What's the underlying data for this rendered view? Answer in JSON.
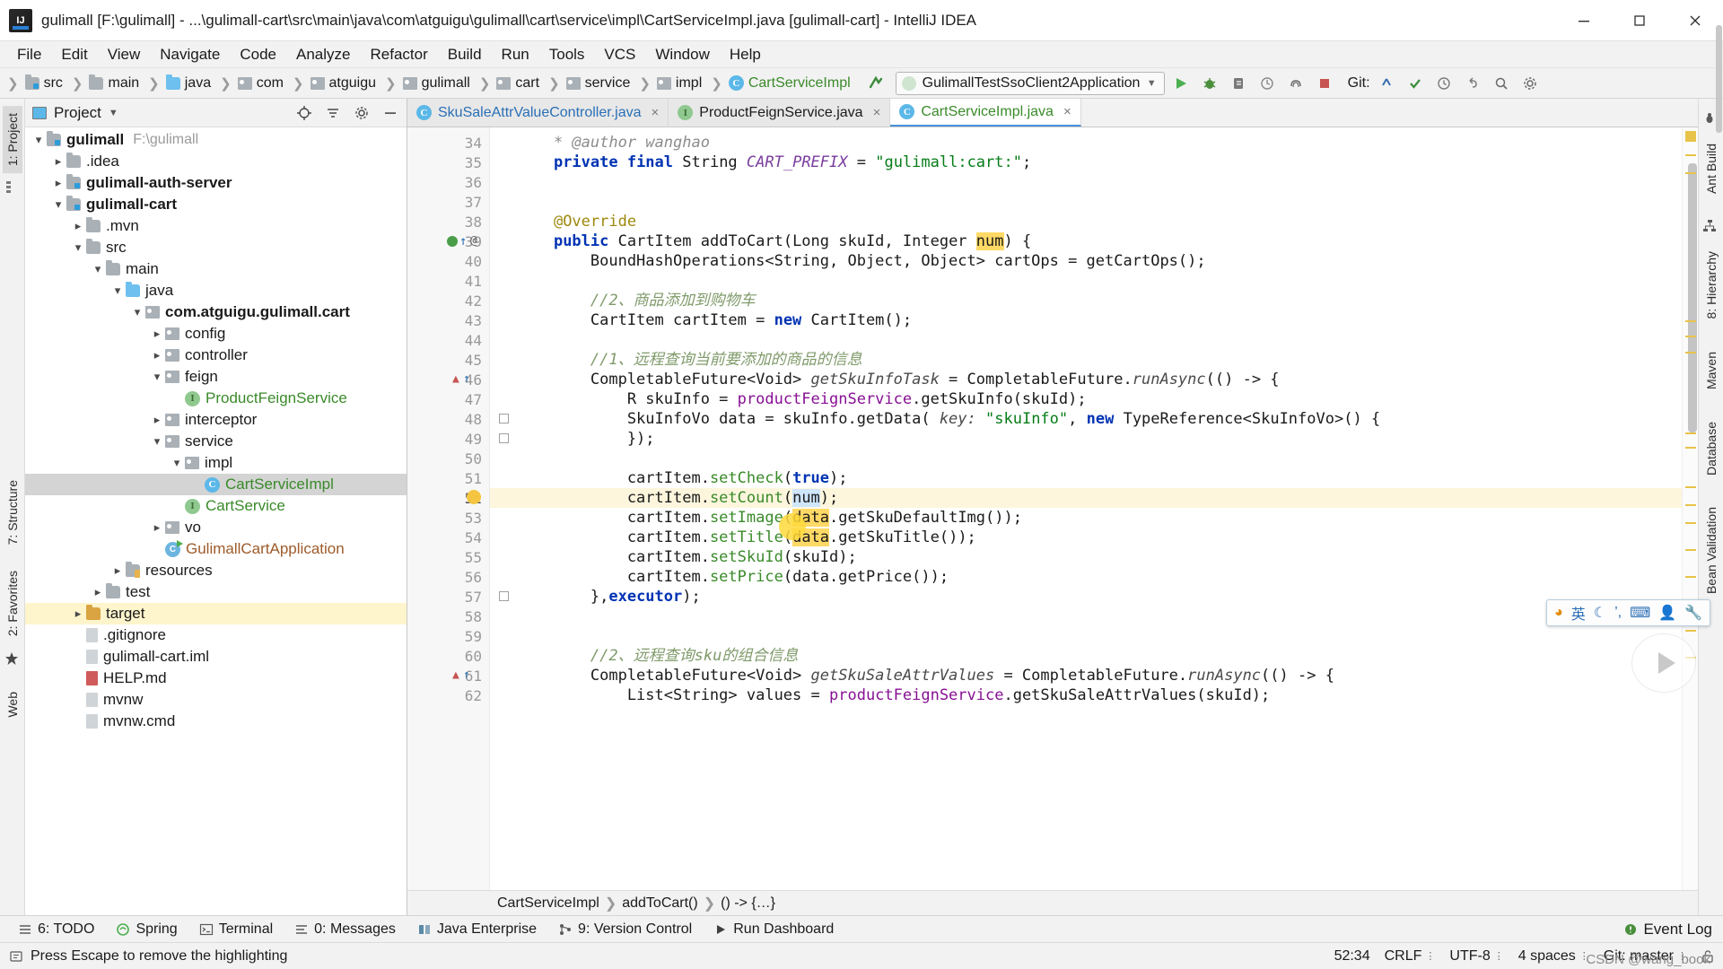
{
  "window": {
    "title": "gulimall [F:\\gulimall] - ...\\gulimall-cart\\src\\main\\java\\com\\atguigu\\gulimall\\cart\\service\\impl\\CartServiceImpl.java [gulimall-cart] - IntelliJ IDEA",
    "app_icon": "intellij-idea-logo",
    "minimize": "minimize-icon",
    "maximize": "maximize-icon",
    "close": "close-icon"
  },
  "menubar": [
    {
      "label": "File"
    },
    {
      "label": "Edit"
    },
    {
      "label": "View"
    },
    {
      "label": "Navigate"
    },
    {
      "label": "Code"
    },
    {
      "label": "Analyze"
    },
    {
      "label": "Refactor"
    },
    {
      "label": "Build"
    },
    {
      "label": "Run"
    },
    {
      "label": "Tools"
    },
    {
      "label": "VCS"
    },
    {
      "label": "Window"
    },
    {
      "label": "Help"
    }
  ],
  "navbar": {
    "crumbs": [
      {
        "label": "src",
        "icon": "folder-src-icon"
      },
      {
        "label": "main",
        "icon": "folder-icon"
      },
      {
        "label": "java",
        "icon": "folder-java-icon"
      },
      {
        "label": "com",
        "icon": "package-icon"
      },
      {
        "label": "atguigu",
        "icon": "package-icon"
      },
      {
        "label": "gulimall",
        "icon": "package-icon"
      },
      {
        "label": "cart",
        "icon": "package-icon"
      },
      {
        "label": "service",
        "icon": "package-icon"
      },
      {
        "label": "impl",
        "icon": "package-icon"
      },
      {
        "label": "CartServiceImpl",
        "icon": "java-class-icon",
        "green": true
      }
    ],
    "run_configuration": "GulimallTestSsoClient2Application",
    "run_config_icon": "spring-boot-icon",
    "buttons": [
      {
        "name": "run-button",
        "icon": "play-icon"
      },
      {
        "name": "debug-button",
        "icon": "bug-icon"
      },
      {
        "name": "run-with-coverage-button",
        "icon": "coverage-icon"
      },
      {
        "name": "profiler-button",
        "icon": "profiler-icon"
      },
      {
        "name": "stop-button",
        "icon": "stop-icon"
      }
    ],
    "git_label": "Git:",
    "git_buttons": [
      {
        "name": "update-project-button",
        "icon": "vcs-update-icon"
      },
      {
        "name": "commit-button",
        "icon": "vcs-commit-icon"
      },
      {
        "name": "history-button",
        "icon": "history-icon"
      },
      {
        "name": "undo-button",
        "icon": "undo-icon"
      },
      {
        "name": "search-everywhere-button",
        "icon": "search-icon"
      },
      {
        "name": "settings-button",
        "icon": "gear-icon"
      }
    ]
  },
  "left_rail": [
    {
      "label": "1: Project",
      "active": true
    },
    {
      "label": "7: Structure",
      "active": false
    },
    {
      "label": "2: Favorites",
      "active": false
    },
    {
      "label": "Web",
      "active": false
    }
  ],
  "right_rail": [
    {
      "label": "Ant Build"
    },
    {
      "label": "8: Hierarchy"
    },
    {
      "label": "Maven"
    },
    {
      "label": "Database"
    },
    {
      "label": "Bean Validation"
    }
  ],
  "project_panel": {
    "title": "Project",
    "caret": "chevron-down-icon",
    "actions": [
      {
        "name": "scroll-from-source-button",
        "icon": "target-icon"
      },
      {
        "name": "collapse-all-button",
        "icon": "collapse-all-icon"
      },
      {
        "name": "settings-button",
        "icon": "gear-icon"
      },
      {
        "name": "hide-button",
        "icon": "minus-icon"
      }
    ],
    "tree": [
      {
        "depth": 0,
        "twist": "v",
        "icon": "module-icon",
        "label": "gulimall",
        "bold": true,
        "path": "F:\\gulimall"
      },
      {
        "depth": 1,
        "twist": ">",
        "icon": "folder-icon",
        "label": ".idea"
      },
      {
        "depth": 1,
        "twist": ">",
        "icon": "module-icon",
        "label": "gulimall-auth-server",
        "bold": true
      },
      {
        "depth": 1,
        "twist": "v",
        "icon": "module-icon",
        "label": "gulimall-cart",
        "bold": true
      },
      {
        "depth": 2,
        "twist": ">",
        "icon": "folder-icon",
        "label": ".mvn"
      },
      {
        "depth": 2,
        "twist": "v",
        "icon": "folder-icon",
        "label": "src"
      },
      {
        "depth": 3,
        "twist": "v",
        "icon": "folder-icon",
        "label": "main"
      },
      {
        "depth": 4,
        "twist": "v",
        "icon": "folder-java-icon",
        "label": "java"
      },
      {
        "depth": 5,
        "twist": "v",
        "icon": "package-icon",
        "label": "com.atguigu.gulimall.cart",
        "bold": true
      },
      {
        "depth": 6,
        "twist": ">",
        "icon": "package-icon",
        "label": "config"
      },
      {
        "depth": 6,
        "twist": ">",
        "icon": "package-icon",
        "label": "controller"
      },
      {
        "depth": 6,
        "twist": "v",
        "icon": "package-icon",
        "label": "feign"
      },
      {
        "depth": 7,
        "twist": "",
        "icon": "java-interface-icon",
        "label": "ProductFeignService",
        "color": "green"
      },
      {
        "depth": 6,
        "twist": ">",
        "icon": "package-icon",
        "label": "interceptor"
      },
      {
        "depth": 6,
        "twist": "v",
        "icon": "package-icon",
        "label": "service"
      },
      {
        "depth": 7,
        "twist": "v",
        "icon": "package-icon",
        "label": "impl"
      },
      {
        "depth": 8,
        "twist": "",
        "icon": "java-class-icon",
        "label": "CartServiceImpl",
        "color": "green",
        "selected": true
      },
      {
        "depth": 7,
        "twist": "",
        "icon": "java-interface-icon",
        "label": "CartService",
        "color": "green"
      },
      {
        "depth": 6,
        "twist": ">",
        "icon": "package-icon",
        "label": "vo"
      },
      {
        "depth": 6,
        "twist": "",
        "icon": "spring-boot-app-icon",
        "label": "GulimallCartApplication",
        "color": "brown"
      },
      {
        "depth": 4,
        "twist": ">",
        "icon": "resources-folder-icon",
        "label": "resources"
      },
      {
        "depth": 3,
        "twist": ">",
        "icon": "folder-icon",
        "label": "test"
      },
      {
        "depth": 2,
        "twist": ">",
        "icon": "target-folder-icon",
        "label": "target",
        "highlight": true
      },
      {
        "depth": 2,
        "twist": "",
        "icon": "file-icon",
        "label": ".gitignore"
      },
      {
        "depth": 2,
        "twist": "",
        "icon": "file-icon",
        "label": "gulimall-cart.iml"
      },
      {
        "depth": 2,
        "twist": "",
        "icon": "markdown-file-icon",
        "label": "HELP.md"
      },
      {
        "depth": 2,
        "twist": "",
        "icon": "file-icon",
        "label": "mvnw"
      },
      {
        "depth": 2,
        "twist": "",
        "icon": "file-icon",
        "label": "mvnw.cmd"
      }
    ]
  },
  "editor": {
    "tabs": [
      {
        "label": "SkuSaleAttrValueController.java",
        "icon": "java-class-icon",
        "color": "blue",
        "active": false,
        "close": "×"
      },
      {
        "label": "ProductFeignService.java",
        "icon": "java-interface-icon",
        "color": "plain",
        "active": false,
        "close": "×"
      },
      {
        "label": "CartServiceImpl.java",
        "icon": "java-class-icon",
        "color": "green",
        "active": true,
        "close": "×"
      }
    ],
    "first_line": 34,
    "lines": [
      {
        "n": 34,
        "html": "    <span class=\"cmt\">* @author wanghao</span>"
      },
      {
        "n": 35,
        "html": "    <span class=\"kw\">private final</span> String <span class=\"const\">CART_PREFIX</span> = <span class=\"str\">\"gulimall:cart:\"</span>;"
      },
      {
        "n": 36,
        "html": ""
      },
      {
        "n": 37,
        "html": ""
      },
      {
        "n": 38,
        "html": "    <span class=\"ann\">@Override</span>"
      },
      {
        "n": 39,
        "html": "    <span class=\"kw\">public</span> CartItem addToCart(Long skuId, Integer <span class=\"hl-yellow\">num</span>) {",
        "mark": "override"
      },
      {
        "n": 40,
        "html": "        BoundHashOperations&lt;String, Object, Object&gt; cartOps = getCartOps();"
      },
      {
        "n": 41,
        "html": ""
      },
      {
        "n": 42,
        "html": "        <span class=\"cmt-cn\">//2、商品添加到购物车</span>"
      },
      {
        "n": 43,
        "html": "        CartItem cartItem = <span class=\"kw\">new</span> CartItem();"
      },
      {
        "n": 44,
        "html": ""
      },
      {
        "n": 45,
        "html": "        <span class=\"cmt-cn\">//1、远程查询当前要添加的商品的信息</span>"
      },
      {
        "n": 46,
        "html": "        CompletableFuture&lt;Void&gt; <span class=\"stat\">getSkuInfoTask</span> = CompletableFuture.<span class=\"stat\">runAsync</span>(() -&gt; {",
        "mark": "lambda"
      },
      {
        "n": 47,
        "html": "            R skuInfo = <span class=\"field-purple\">productFeignService</span>.getSkuInfo(skuId);"
      },
      {
        "n": 48,
        "html": "            SkuInfoVo data = skuInfo.getData( <span class=\"param\">key:</span> <span class=\"str\">\"skuInfo\"</span>, <span class=\"kw\">new</span> TypeReference&lt;SkuInfoVo&gt;() {",
        "fold": true
      },
      {
        "n": 49,
        "html": "            });",
        "fold": true
      },
      {
        "n": 50,
        "html": ""
      },
      {
        "n": 51,
        "html": "            cartItem.<span class=\"class-green\">setCheck</span>(<span class=\"kw\">true</span>);"
      },
      {
        "n": 52,
        "html": "            cartItem.<span class=\"class-green\">setCount</span>(<span class=\"hl-blue\">num</span>);",
        "current": true
      },
      {
        "n": 53,
        "html": "            cartItem.<span class=\"class-green\">setImage</span>(<span class=\"hl-yellow\">data</span>.getSkuDefaultImg());"
      },
      {
        "n": 54,
        "html": "            cartItem.<span class=\"class-green\">setTitle</span>(<span class=\"hl-yellow\">data</span>.getSkuTitle());"
      },
      {
        "n": 55,
        "html": "            cartItem.<span class=\"class-green\">setSkuId</span>(skuId);"
      },
      {
        "n": 56,
        "html": "            cartItem.<span class=\"class-green\">setPrice</span>(data.getPrice());"
      },
      {
        "n": 57,
        "html": "        },<span class=\"kw\">executor</span>);",
        "fold": true
      },
      {
        "n": 58,
        "html": ""
      },
      {
        "n": 59,
        "html": ""
      },
      {
        "n": 60,
        "html": "        <span class=\"cmt-cn\">//2、远程查询</span><span class=\"cmt-cn\">sku</span><span class=\"cmt-cn\">的组合信息</span>"
      },
      {
        "n": 61,
        "html": "        CompletableFuture&lt;Void&gt; <span class=\"stat\">getSkuSaleAttrValues</span> = CompletableFuture.<span class=\"stat\">runAsync</span>(() -&gt; {",
        "mark": "lambda"
      },
      {
        "n": 62,
        "html": "            List&lt;String&gt; values = <span class=\"field-purple\">productFeignService</span>.getSkuSaleAttrValues(skuId);"
      }
    ],
    "breadcrumbs": [
      "CartServiceImpl",
      "addToCart()",
      "() -> {…}"
    ]
  },
  "bottom_toolwindows": [
    {
      "label": "6: TODO",
      "icon": "todo-icon"
    },
    {
      "label": "Spring",
      "icon": "spring-icon"
    },
    {
      "label": "Terminal",
      "icon": "terminal-icon"
    },
    {
      "label": "0: Messages",
      "icon": "messages-icon"
    },
    {
      "label": "Java Enterprise",
      "icon": "java-ee-icon"
    },
    {
      "label": "9: Version Control",
      "icon": "version-control-icon"
    },
    {
      "label": "Run Dashboard",
      "icon": "run-dashboard-icon"
    }
  ],
  "event_log": {
    "label": "Event Log",
    "icon": "event-log-icon"
  },
  "statusbar": {
    "message": "Press Escape to remove the highlighting",
    "message_icon": "info-icon",
    "caret_position": "52:34",
    "line_separator": "CRLF",
    "encoding": "UTF-8",
    "indent": "4 spaces",
    "branch": "Git: master",
    "lock_icon": "unlocked-icon"
  },
  "ime_bar": {
    "items": [
      "sogou-logo",
      "英",
      "moon-icon",
      "punctuation-icon",
      "keyboard-icon",
      "user-icon",
      "tools-icon"
    ],
    "mode_label": "英"
  },
  "watermark": "CSDN @wang_book",
  "colors": {
    "accent": "#4a90d9",
    "selection": "#d4d4d4",
    "current_line": "#fdf6dd",
    "highlight_yellow": "#ffd966",
    "string_green": "#067d17",
    "keyword_blue": "#0033b3",
    "comment_cn": "#7f9a6a"
  }
}
